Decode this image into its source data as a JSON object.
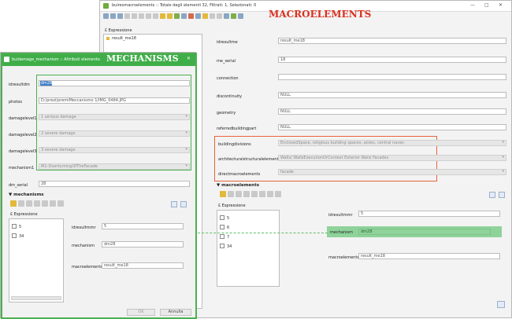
{
  "macro_window": {
    "title": "buiresmacroelements :: Totale degli elementi 32, Filtrati: 1, Selezionati: 0",
    "banner": "MACROELEMENTS",
    "expression_label": "Espressione",
    "list_item": "result_me18",
    "fields": [
      {
        "label": "idresultme",
        "value": "result_me18"
      },
      {
        "label": "me_serial",
        "value": "18"
      },
      {
        "label": "connection",
        "value": ""
      },
      {
        "label": "discontinuity",
        "value": "NULL"
      },
      {
        "label": "geometry",
        "value": "NULL"
      },
      {
        "label": "referredbuildingpart",
        "value": "NULL"
      }
    ],
    "red_fields": [
      {
        "label": "buildingdivisions",
        "value": "EnclosedSpace, religious building spaces, aisles, central naves"
      },
      {
        "label": "architecturalstructuralelements",
        "value": "Walls/ WallsExecutionOrContext Exterior Walls Facades"
      },
      {
        "label": "directmacroelements",
        "value": "facade"
      }
    ],
    "subform_title": "macroelements",
    "sub_list_header": "Espressione",
    "sub_list_items": [
      "5",
      "6",
      "7",
      "34"
    ],
    "sub_fields": [
      {
        "label": "idresultmmr",
        "value": "5"
      },
      {
        "label": "mechanism",
        "value": "dm28"
      },
      {
        "label": "macroelements",
        "value": "result_me18"
      }
    ]
  },
  "mech_window": {
    "title": "buidamage_mechanism :: Attributi elemento",
    "banner": "MECHANISMS",
    "fields": [
      {
        "label": "idresultdm",
        "value": "dm28",
        "state": "selected"
      },
      {
        "label": "photos",
        "value": "D:/prezi/premiMeccanismo 1/IMG_0484.JPG",
        "state": "normal"
      },
      {
        "label": "damagelevel1",
        "value": "1 serious damage",
        "state": "disabled"
      },
      {
        "label": "damagelevel2",
        "value": "2 severe damage",
        "state": "disabled"
      },
      {
        "label": "damagelevel3",
        "value": "3 severe damage",
        "state": "disabled"
      },
      {
        "label": "mechanism1",
        "value": "M1-OverturningOfTheFacade",
        "state": "disabled"
      }
    ],
    "dm_serial_label": "dm_serial",
    "dm_serial_value": "28",
    "subform_title": "mechanisms",
    "sub_list_header": "Espressione",
    "sub_list_items": [
      "5",
      "34"
    ],
    "sub_fields": [
      {
        "label": "idresultmmr",
        "value": "5"
      },
      {
        "label": "mechanism",
        "value": "dm28"
      },
      {
        "label": "macroelements",
        "value": "result_me18"
      }
    ],
    "ok_label": "OK",
    "cancel_label": "Annulla"
  },
  "colors": {
    "highlight_red": "#e8643b",
    "highlight_green": "#4caf50",
    "banner_red": "#d9301f",
    "banner_green": "#3fae49"
  }
}
